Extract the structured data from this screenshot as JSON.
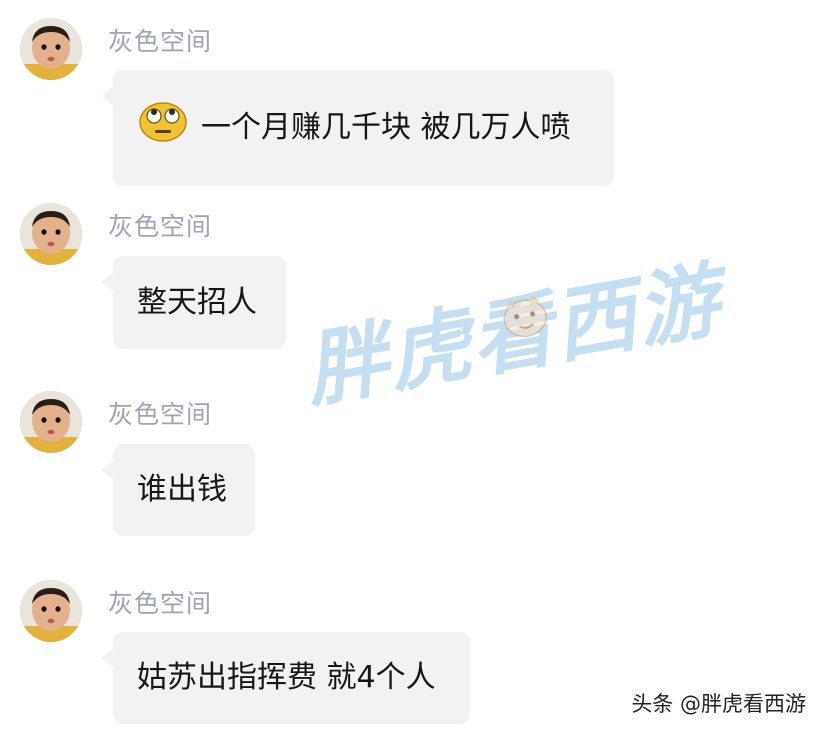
{
  "colors": {
    "background": "#ffffff",
    "bubble": "#f2f2f2",
    "sender_name": "#9ea3b8",
    "message_text": "#161616",
    "watermark": "#96c4e8"
  },
  "messages": [
    {
      "sender": "灰色空间",
      "text": "一个月赚几千块 被几万人喷",
      "emoji": "face-with-rolling-eyes-icon"
    },
    {
      "sender": "灰色空间",
      "text": "整天招人"
    },
    {
      "sender": "灰色空间",
      "text": "谁出钱"
    },
    {
      "sender": "灰色空间",
      "text": "姑苏出指挥费 就4个人"
    }
  ],
  "watermark": {
    "text": "胖虎看西游",
    "icon": "cartoon-face-icon"
  },
  "source_tag": "头条 @胖虎看西游"
}
